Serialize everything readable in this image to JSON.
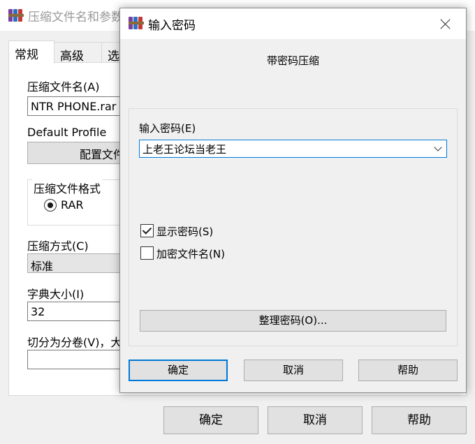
{
  "parent": {
    "title": "压缩文件名和参数",
    "tabs": [
      "常规",
      "高级",
      "选"
    ],
    "archive_name_label": "压缩文件名(A)",
    "archive_name_value": "NTR PHONE.rar",
    "default_profile_label": "Default Profile",
    "profiles_button": "配置文件",
    "format_group_label": "压缩文件格式",
    "format_rar": "RAR",
    "method_label": "压缩方式(C)",
    "method_value": "标准",
    "dict_label": "字典大小(I)",
    "dict_value": "32",
    "split_label": "切分为分卷(V)，大",
    "split_value": "",
    "ok_label": "确定",
    "cancel_label": "取消",
    "help_label": "帮助"
  },
  "dialog": {
    "title": "输入密码",
    "heading": "带密码压缩",
    "password_label": "输入密码(E)",
    "password_value": "上老王论坛当老王",
    "show_password_label": "显示密码(S)",
    "show_password_checked": true,
    "encrypt_names_label": "加密文件名(N)",
    "encrypt_names_checked": false,
    "organize_label": "整理密码(O)...",
    "ok_label": "确定",
    "cancel_label": "取消",
    "help_label": "帮助"
  },
  "colors": {
    "accent": "#0078d7",
    "button_face": "#e1e1e1",
    "dialog_face": "#f0f0f0"
  },
  "icons": {
    "app": "winrar-books-icon",
    "close": "close-icon",
    "dropdown": "chevron-down-icon",
    "check": "checkmark-icon",
    "radio": "radio-selected-icon"
  }
}
